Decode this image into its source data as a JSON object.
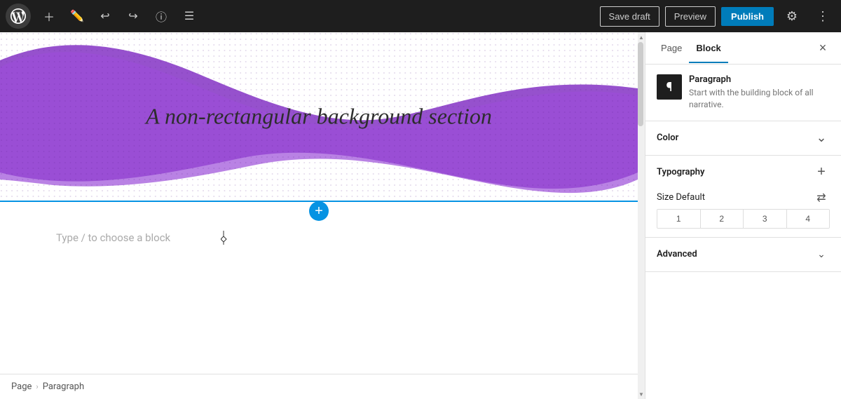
{
  "toolbar": {
    "wp_logo_label": "WordPress",
    "add_button_label": "+",
    "tools_label": "Tools",
    "undo_label": "Undo",
    "redo_label": "Redo",
    "block_info_label": "Block information",
    "list_view_label": "List view",
    "save_draft_label": "Save draft",
    "preview_label": "Preview",
    "publish_label": "Publish",
    "settings_label": "Settings",
    "more_label": "More"
  },
  "canvas": {
    "wave_text": "A non-rectangular background section",
    "placeholder_text": "Type / to choose a block",
    "block_inserter_label": "+"
  },
  "breadcrumb": {
    "page_label": "Page",
    "separator": "›",
    "paragraph_label": "Paragraph"
  },
  "sidebar": {
    "tab_page_label": "Page",
    "tab_block_label": "Block",
    "close_label": "×",
    "block_icon": "¶",
    "block_title": "Paragraph",
    "block_desc": "Start with the building block of all narrative.",
    "color_section_title": "Color",
    "typography_section_title": "Typography",
    "size_label": "Size Default",
    "size_options": [
      "1",
      "2",
      "3",
      "4"
    ],
    "advanced_section_title": "Advanced"
  },
  "colors": {
    "accent": "#007cba",
    "wave_fill": "#8b3ec8",
    "toolbar_bg": "#1e1e1e",
    "inserter_line": "#0693e3"
  }
}
